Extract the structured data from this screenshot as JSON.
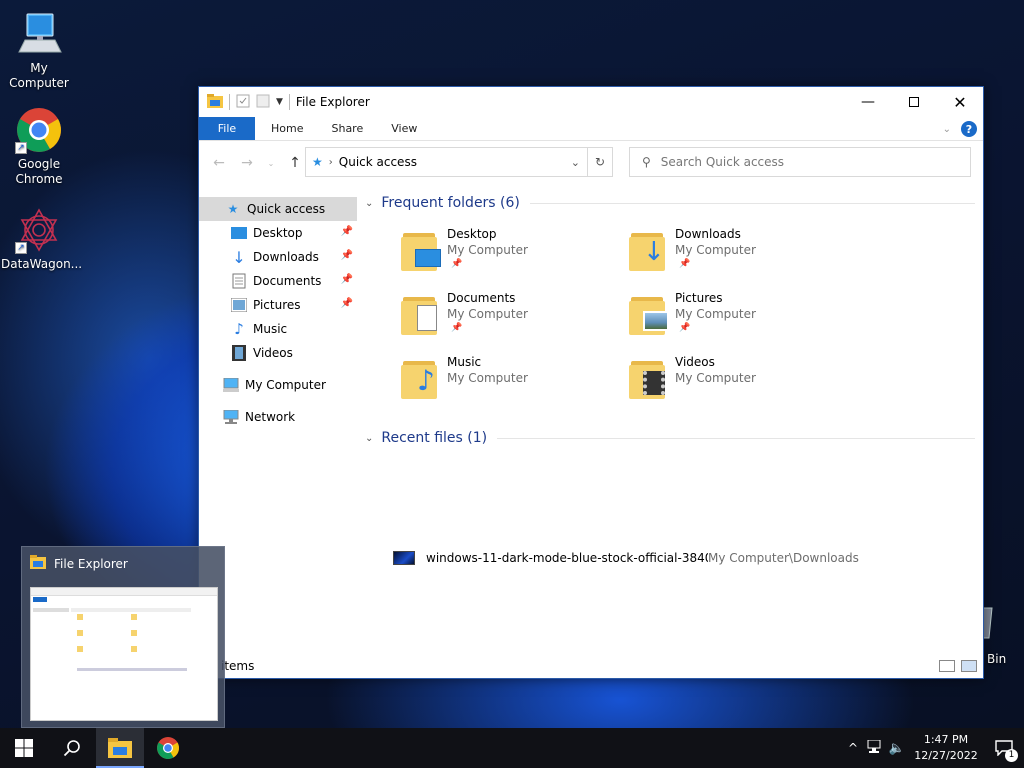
{
  "desktop": {
    "icons": [
      {
        "label": "My Computer",
        "icon": "computer-icon"
      },
      {
        "label": "Google\nChrome",
        "icon": "chrome-icon"
      },
      {
        "label": "DataWagon...",
        "icon": "datawagon-icon"
      }
    ],
    "recycle_bin_label": "Bin"
  },
  "window": {
    "title": "File Explorer",
    "ribbon_tabs": [
      "File",
      "Home",
      "Share",
      "View"
    ],
    "address": "Quick access",
    "search_placeholder": "Search Quick access",
    "nav": [
      {
        "label": "Quick access",
        "icon": "star-icon",
        "selected": true
      },
      {
        "label": "Desktop",
        "icon": "desktop-icon",
        "pinned": true
      },
      {
        "label": "Downloads",
        "icon": "download-icon",
        "pinned": true
      },
      {
        "label": "Documents",
        "icon": "document-icon",
        "pinned": true
      },
      {
        "label": "Pictures",
        "icon": "picture-icon",
        "pinned": true
      },
      {
        "label": "Music",
        "icon": "music-icon"
      },
      {
        "label": "Videos",
        "icon": "video-icon"
      },
      {
        "label": "My Computer",
        "icon": "computer-icon"
      },
      {
        "label": "Network",
        "icon": "network-icon"
      }
    ],
    "frequent_header": "Frequent folders (6)",
    "frequent": [
      {
        "name": "Desktop",
        "location": "My Computer"
      },
      {
        "name": "Downloads",
        "location": "My Computer"
      },
      {
        "name": "Documents",
        "location": "My Computer"
      },
      {
        "name": "Pictures",
        "location": "My Computer"
      },
      {
        "name": "Music",
        "location": "My Computer"
      },
      {
        "name": "Videos",
        "location": "My Computer"
      }
    ],
    "recent_header": "Recent files (1)",
    "recent": [
      {
        "name": "windows-11-dark-mode-blue-stock-official-3840...",
        "path": "My Computer\\Downloads"
      }
    ],
    "status": "items"
  },
  "preview": {
    "title": "File Explorer"
  },
  "taskbar": {
    "apps": [
      "start-icon",
      "search-icon",
      "file-explorer-icon",
      "chrome-icon"
    ],
    "time": "1:47 PM",
    "date": "12/27/2022",
    "notification_count": "1"
  },
  "colors": {
    "accent": "#1a6ac8",
    "folder": "#f6d36e",
    "taskbar": "#101116"
  }
}
